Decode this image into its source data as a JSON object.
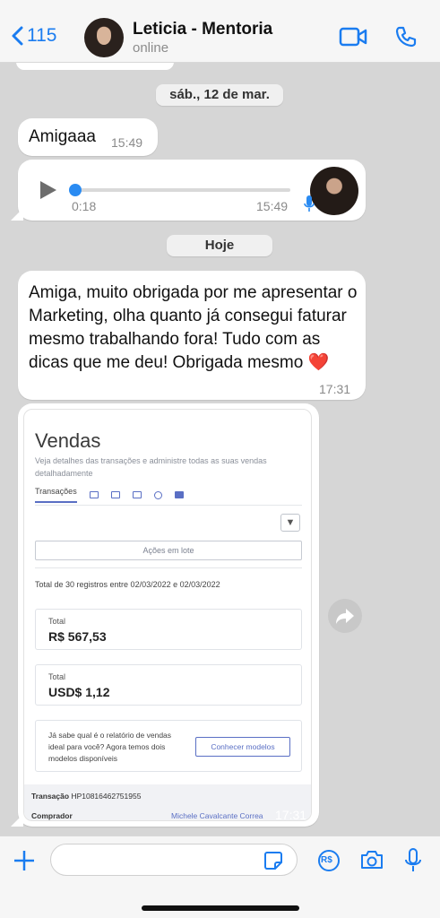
{
  "header": {
    "back_count": "115",
    "contact_name": "Leticia - Mentoria",
    "status": "online"
  },
  "chat": {
    "date1": "sáb., 12 de mar.",
    "msg1": {
      "text": "Amigaaa",
      "time": "15:49"
    },
    "audio": {
      "position": "0:18",
      "time": "15:49",
      "progress": 0.0
    },
    "date2": "Hoje",
    "msg2": {
      "text": "Amiga, muito obrigada por me apresentar o Marketing, olha quanto já consegui faturar mesmo trabalhando fora! Tudo com as dicas que me deu! Obrigada mesmo ❤️",
      "time": "17:31"
    },
    "image": {
      "time": "17:31",
      "title": "Vendas",
      "subtitle": "Veja detalhes das transações e administre todas as suas vendas detalhadamente",
      "tab_active": "Transações",
      "batch_button": "Ações em lote",
      "total_line": "Total de 30 registros entre 02/03/2022 e 02/03/2022",
      "card1": {
        "label": "Total",
        "value": "R$ 567,53"
      },
      "card2": {
        "label": "Total",
        "value": "USD$ 1,12"
      },
      "info_text": "Já sabe qual é o relatório de vendas ideal para você? Agora temos dois modelos disponíveis",
      "info_button": "Conhecer modelos",
      "transaction_label": "Transação",
      "transaction_id": "HP10816462751955",
      "buyer_label": "Comprador",
      "buyer_name": "Michele Cavalcante Correa"
    }
  },
  "footer": {
    "input_placeholder": "",
    "pix_label": "R$"
  },
  "colors": {
    "accent": "#1a7cf0",
    "chat_bg": "#d6d6d6",
    "bubble": "#ffffff"
  }
}
